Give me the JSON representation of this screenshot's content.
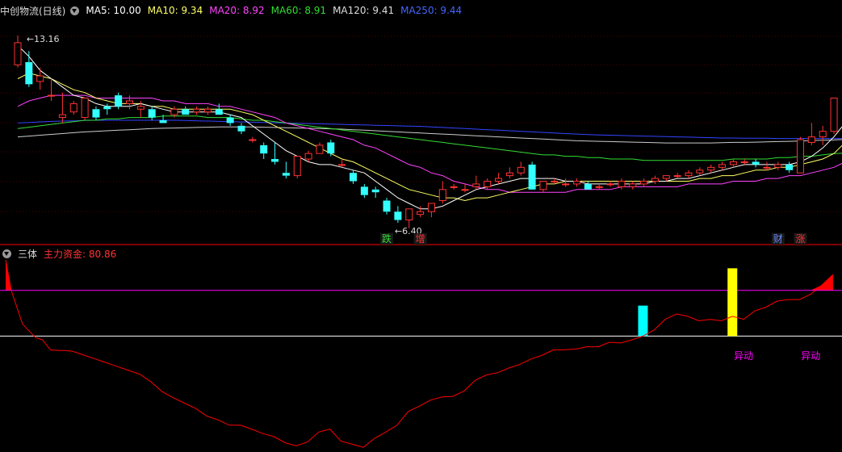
{
  "main_header": {
    "title": "中创物流(日线)",
    "ma": [
      {
        "label": "MA5: 10.00",
        "color": "#ffffff"
      },
      {
        "label": "MA10: 9.34",
        "color": "#ffff66"
      },
      {
        "label": "MA20: 8.92",
        "color": "#ff44ff"
      },
      {
        "label": "MA60: 8.91",
        "color": "#33dd33"
      },
      {
        "label": "MA120: 9.41",
        "color": "#dddddd"
      },
      {
        "label": "MA250: 9.44",
        "color": "#3344ff"
      }
    ]
  },
  "sub_header": {
    "name": "三体",
    "indicator_label": "主力资金: 80.86"
  },
  "colors": {
    "up": "#ff3333",
    "down": "#33ffff",
    "ma5": "#ffffff",
    "ma10": "#ffff66",
    "ma20": "#ff44ff",
    "ma60": "#33dd33",
    "ma250": "#3344ff",
    "grid": "#550000",
    "divider": "#aa0000",
    "signal_cyan": "#00ffff",
    "signal_yellow": "#ffff00",
    "line_white": "#ffffff",
    "line_magenta": "#ff00ff",
    "line_red": "#ff0000"
  },
  "chart_data": [
    {
      "type": "candlestick",
      "title": "中创物流(日线)",
      "ylim": [
        5.7,
        13.8
      ],
      "candles": [
        [
          12.1,
          13.16,
          12.0,
          12.9
        ],
        [
          12.2,
          12.6,
          11.3,
          11.4
        ],
        [
          11.5,
          12.0,
          11.2,
          11.7
        ],
        [
          11.0,
          11.6,
          10.8,
          11.0
        ],
        [
          10.2,
          11.1,
          10.0,
          10.3
        ],
        [
          10.4,
          10.8,
          10.3,
          10.7
        ],
        [
          10.2,
          10.9,
          10.1,
          10.9
        ],
        [
          10.5,
          10.6,
          10.1,
          10.2
        ],
        [
          10.6,
          10.7,
          10.3,
          10.5
        ],
        [
          11.0,
          11.1,
          10.5,
          10.6
        ],
        [
          10.7,
          11.0,
          10.5,
          10.8
        ],
        [
          10.5,
          10.8,
          10.2,
          10.6
        ],
        [
          10.5,
          10.6,
          10.1,
          10.2
        ],
        [
          10.1,
          10.3,
          10.0,
          10.0
        ],
        [
          10.3,
          10.6,
          10.2,
          10.5
        ],
        [
          10.5,
          10.6,
          10.3,
          10.3
        ],
        [
          10.4,
          10.6,
          10.3,
          10.5
        ],
        [
          10.4,
          10.6,
          10.3,
          10.5
        ],
        [
          10.5,
          10.7,
          10.3,
          10.3
        ],
        [
          10.2,
          10.3,
          9.9,
          10.0
        ],
        [
          9.9,
          10.0,
          9.6,
          9.7
        ],
        [
          9.4,
          9.5,
          9.3,
          9.4
        ],
        [
          9.2,
          9.3,
          8.7,
          8.9
        ],
        [
          8.7,
          9.3,
          8.5,
          8.6
        ],
        [
          8.2,
          8.6,
          8.0,
          8.1
        ],
        [
          8.1,
          8.8,
          8.0,
          8.8
        ],
        [
          8.7,
          9.0,
          8.6,
          8.9
        ],
        [
          8.9,
          9.3,
          8.9,
          9.2
        ],
        [
          9.3,
          9.4,
          8.8,
          8.9
        ],
        [
          8.5,
          8.7,
          8.4,
          8.5
        ],
        [
          8.2,
          8.3,
          7.8,
          7.9
        ],
        [
          7.7,
          7.8,
          7.3,
          7.4
        ],
        [
          7.6,
          7.7,
          7.3,
          7.5
        ],
        [
          7.2,
          7.3,
          6.7,
          6.8
        ],
        [
          6.8,
          7.0,
          6.4,
          6.5
        ],
        [
          6.5,
          6.9,
          6.2,
          6.9
        ],
        [
          6.7,
          7.0,
          6.6,
          6.8
        ],
        [
          6.8,
          7.1,
          6.6,
          7.1
        ],
        [
          7.2,
          7.9,
          7.1,
          7.6
        ],
        [
          7.7,
          7.8,
          7.6,
          7.7
        ],
        [
          7.6,
          7.8,
          7.5,
          7.6
        ],
        [
          7.7,
          8.1,
          7.6,
          7.8
        ],
        [
          7.7,
          8.0,
          7.6,
          7.9
        ],
        [
          7.9,
          8.2,
          7.8,
          8.0
        ],
        [
          8.1,
          8.4,
          8.0,
          8.2
        ],
        [
          8.2,
          8.6,
          8.1,
          8.4
        ],
        [
          8.5,
          8.6,
          7.6,
          7.6
        ],
        [
          7.6,
          7.9,
          7.5,
          7.9
        ],
        [
          7.9,
          8.0,
          7.8,
          7.9
        ],
        [
          7.8,
          8.0,
          7.7,
          7.8
        ],
        [
          7.8,
          8.0,
          7.7,
          7.9
        ],
        [
          7.8,
          7.9,
          7.6,
          7.6
        ],
        [
          7.7,
          7.8,
          7.6,
          7.7
        ],
        [
          7.8,
          7.9,
          7.7,
          7.8
        ],
        [
          7.7,
          8.0,
          7.6,
          7.9
        ],
        [
          7.7,
          7.9,
          7.6,
          7.8
        ],
        [
          7.8,
          8.0,
          7.7,
          7.9
        ],
        [
          7.9,
          8.1,
          7.8,
          8.0
        ],
        [
          8.0,
          8.1,
          7.9,
          8.1
        ],
        [
          8.1,
          8.2,
          8.0,
          8.1
        ],
        [
          8.1,
          8.3,
          8.0,
          8.2
        ],
        [
          8.2,
          8.4,
          8.1,
          8.3
        ],
        [
          8.3,
          8.5,
          8.2,
          8.4
        ],
        [
          8.4,
          8.6,
          8.3,
          8.5
        ],
        [
          8.5,
          8.7,
          8.4,
          8.6
        ],
        [
          8.6,
          8.7,
          8.5,
          8.6
        ],
        [
          8.6,
          8.7,
          8.4,
          8.5
        ],
        [
          8.4,
          8.6,
          8.3,
          8.4
        ],
        [
          8.4,
          8.6,
          8.3,
          8.5
        ],
        [
          8.5,
          8.6,
          8.2,
          8.3
        ],
        [
          8.2,
          9.5,
          8.2,
          9.4
        ],
        [
          9.3,
          10.0,
          9.2,
          9.5
        ],
        [
          9.5,
          9.9,
          9.2,
          9.7
        ],
        [
          9.7,
          10.9,
          9.6,
          10.9
        ]
      ],
      "ma5": [
        12.8,
        12.4,
        11.9,
        11.6,
        11.3,
        11.0,
        10.9,
        10.7,
        10.6,
        10.6,
        10.6,
        10.7,
        10.6,
        10.5,
        10.4,
        10.4,
        10.4,
        10.4,
        10.4,
        10.3,
        10.2,
        9.9,
        9.6,
        9.3,
        9.0,
        8.8,
        8.6,
        8.5,
        8.5,
        8.4,
        8.3,
        8.2,
        7.9,
        7.6,
        7.3,
        7.1,
        6.9,
        6.9,
        7.0,
        7.2,
        7.4,
        7.6,
        7.7,
        7.8,
        7.9,
        8.0,
        8.0,
        8.0,
        8.0,
        7.9,
        7.9,
        7.8,
        7.8,
        7.8,
        7.8,
        7.8,
        7.8,
        7.9,
        7.9,
        8.0,
        8.0,
        8.1,
        8.2,
        8.3,
        8.4,
        8.5,
        8.5,
        8.5,
        8.5,
        8.5,
        8.6,
        8.8,
        9.1,
        9.5,
        10.0
      ],
      "ma10": [
        11.6,
        11.8,
        11.7,
        11.6,
        11.4,
        11.2,
        11.1,
        10.9,
        10.8,
        10.7,
        10.7,
        10.7,
        10.6,
        10.6,
        10.5,
        10.5,
        10.5,
        10.5,
        10.5,
        10.5,
        10.4,
        10.3,
        10.1,
        9.9,
        9.7,
        9.5,
        9.3,
        9.1,
        8.9,
        8.7,
        8.6,
        8.4,
        8.2,
        8.0,
        7.8,
        7.6,
        7.5,
        7.4,
        7.3,
        7.3,
        7.2,
        7.3,
        7.3,
        7.4,
        7.5,
        7.6,
        7.7,
        7.8,
        7.8,
        7.9,
        7.9,
        7.9,
        7.9,
        7.9,
        7.9,
        7.9,
        7.9,
        7.9,
        7.9,
        7.9,
        7.9,
        8.0,
        8.0,
        8.1,
        8.1,
        8.2,
        8.3,
        8.3,
        8.4,
        8.4,
        8.5,
        8.6,
        8.7,
        8.9,
        9.3
      ],
      "ma20": [
        10.6,
        10.8,
        10.9,
        11.0,
        11.0,
        11.0,
        11.0,
        10.9,
        10.9,
        10.9,
        10.9,
        10.9,
        10.9,
        10.8,
        10.8,
        10.7,
        10.7,
        10.7,
        10.6,
        10.6,
        10.5,
        10.4,
        10.3,
        10.2,
        10.0,
        9.9,
        9.8,
        9.7,
        9.6,
        9.5,
        9.4,
        9.2,
        9.1,
        8.9,
        8.7,
        8.5,
        8.4,
        8.2,
        8.1,
        7.9,
        7.8,
        7.7,
        7.6,
        7.6,
        7.5,
        7.5,
        7.5,
        7.5,
        7.5,
        7.5,
        7.6,
        7.6,
        7.6,
        7.6,
        7.7,
        7.7,
        7.7,
        7.7,
        7.7,
        7.7,
        7.8,
        7.8,
        7.8,
        7.8,
        7.9,
        7.9,
        7.9,
        8.0,
        8.0,
        8.1,
        8.1,
        8.2,
        8.3,
        8.4,
        8.6
      ],
      "ma60": [
        9.8,
        9.85,
        9.9,
        9.95,
        10.0,
        10.05,
        10.1,
        10.1,
        10.15,
        10.15,
        10.2,
        10.2,
        10.2,
        10.25,
        10.25,
        10.25,
        10.25,
        10.2,
        10.2,
        10.2,
        10.15,
        10.1,
        10.1,
        10.05,
        10.0,
        9.95,
        9.9,
        9.85,
        9.8,
        9.75,
        9.7,
        9.65,
        9.6,
        9.55,
        9.5,
        9.45,
        9.4,
        9.35,
        9.3,
        9.25,
        9.2,
        9.15,
        9.1,
        9.05,
        9.0,
        8.95,
        8.9,
        8.85,
        8.85,
        8.8,
        8.8,
        8.75,
        8.75,
        8.7,
        8.7,
        8.7,
        8.65,
        8.65,
        8.65,
        8.65,
        8.65,
        8.65,
        8.65,
        8.65,
        8.7,
        8.7,
        8.7,
        8.7,
        8.75,
        8.75,
        8.8,
        8.8,
        8.85,
        8.9,
        8.91
      ],
      "ma120": [
        9.5,
        9.53,
        9.56,
        9.59,
        9.62,
        9.65,
        9.68,
        9.7,
        9.72,
        9.74,
        9.76,
        9.78,
        9.8,
        9.81,
        9.82,
        9.83,
        9.84,
        9.85,
        9.86,
        9.86,
        9.86,
        9.86,
        9.85,
        9.84,
        9.83,
        9.82,
        9.81,
        9.8,
        9.79,
        9.78,
        9.76,
        9.74,
        9.72,
        9.7,
        9.68,
        9.66,
        9.64,
        9.62,
        9.6,
        9.58,
        9.56,
        9.54,
        9.52,
        9.5,
        9.48,
        9.46,
        9.44,
        9.42,
        9.4,
        9.38,
        9.36,
        9.35,
        9.34,
        9.33,
        9.32,
        9.31,
        9.3,
        9.29,
        9.28,
        9.28,
        9.28,
        9.28,
        9.28,
        9.29,
        9.3,
        9.3,
        9.31,
        9.32,
        9.33,
        9.34,
        9.35,
        9.37,
        9.38,
        9.39,
        9.41
      ],
      "ma250": [
        10.0,
        10.02,
        10.04,
        10.06,
        10.07,
        10.08,
        10.09,
        10.1,
        10.1,
        10.1,
        10.1,
        10.1,
        10.1,
        10.1,
        10.1,
        10.09,
        10.08,
        10.07,
        10.06,
        10.05,
        10.04,
        10.03,
        10.02,
        10.01,
        10.0,
        9.99,
        9.98,
        9.97,
        9.96,
        9.95,
        9.94,
        9.93,
        9.92,
        9.91,
        9.9,
        9.89,
        9.88,
        9.86,
        9.84,
        9.82,
        9.8,
        9.78,
        9.76,
        9.74,
        9.72,
        9.7,
        9.68,
        9.66,
        9.64,
        9.62,
        9.6,
        9.58,
        9.57,
        9.56,
        9.55,
        9.54,
        9.53,
        9.52,
        9.51,
        9.5,
        9.49,
        9.48,
        9.47,
        9.46,
        9.46,
        9.45,
        9.45,
        9.45,
        9.44,
        9.44,
        9.44,
        9.44,
        9.44,
        9.44,
        9.44
      ],
      "annotations": [
        {
          "text": "13.16",
          "x": 1,
          "y": 13.16
        },
        {
          "text": "6.40",
          "x": 34,
          "y": 6.4
        },
        {
          "text": "跌",
          "x": 33,
          "color": "#33dd33"
        },
        {
          "text": "增",
          "x": 36,
          "color": "#ff3333"
        },
        {
          "text": "财",
          "x": 68,
          "color": "#6688ff"
        },
        {
          "text": "涨",
          "x": 70,
          "color": "#ff3333"
        }
      ]
    },
    {
      "type": "line",
      "title": "三体",
      "series_name": "主力资金",
      "last_value": 80.86,
      "ylim": [
        -150,
        100
      ],
      "fill_above": 60,
      "hline_magenta": 60,
      "hline_white": 0,
      "values": [
        [
          0,
          100
        ],
        [
          0.5,
          60
        ],
        [
          1,
          38
        ],
        [
          1.5,
          16
        ],
        [
          2,
          8
        ],
        [
          2.7,
          -2
        ],
        [
          3.3,
          -5
        ],
        [
          4,
          -18
        ],
        [
          4.7,
          -19
        ],
        [
          5.3,
          -19
        ],
        [
          6,
          -20
        ],
        [
          7,
          -25
        ],
        [
          8,
          -30
        ],
        [
          9,
          -35
        ],
        [
          10,
          -40
        ],
        [
          11,
          -45
        ],
        [
          12,
          -50
        ],
        [
          13,
          -60
        ],
        [
          14,
          -73
        ],
        [
          15,
          -81
        ],
        [
          16,
          -88
        ],
        [
          17,
          -95
        ],
        [
          18,
          -105
        ],
        [
          19,
          -110
        ],
        [
          20,
          -117
        ],
        [
          21,
          -117
        ],
        [
          22,
          -122
        ],
        [
          23,
          -128
        ],
        [
          24,
          -132
        ],
        [
          25,
          -140
        ],
        [
          26,
          -144
        ],
        [
          27,
          -139
        ],
        [
          28,
          -126
        ],
        [
          29,
          -122
        ],
        [
          30,
          -138
        ],
        [
          31,
          -142
        ],
        [
          32,
          -146
        ],
        [
          33,
          -134
        ],
        [
          34,
          -126
        ],
        [
          35,
          -117
        ],
        [
          36,
          -99
        ],
        [
          37,
          -92
        ],
        [
          38,
          -84
        ],
        [
          39,
          -80
        ],
        [
          40,
          -79
        ],
        [
          41,
          -72
        ],
        [
          42,
          -58
        ],
        [
          43,
          -51
        ],
        [
          44,
          -48
        ],
        [
          45,
          -42
        ],
        [
          46,
          -37
        ],
        [
          47,
          -30
        ],
        [
          48,
          -25
        ],
        [
          49,
          -18
        ],
        [
          50,
          -18
        ],
        [
          51,
          -17
        ],
        [
          52,
          -14
        ],
        [
          53,
          -14
        ],
        [
          54,
          -8
        ],
        [
          55,
          -9
        ],
        [
          56,
          -5
        ],
        [
          57,
          0
        ],
        [
          58,
          8
        ],
        [
          59,
          22
        ],
        [
          60,
          29
        ],
        [
          61,
          26
        ],
        [
          62,
          20
        ],
        [
          63,
          22
        ],
        [
          64,
          20
        ],
        [
          65,
          26
        ],
        [
          66,
          22
        ],
        [
          67,
          33
        ],
        [
          68,
          38
        ],
        [
          69,
          46
        ],
        [
          70,
          48
        ],
        [
          71,
          48
        ],
        [
          72,
          55
        ],
        [
          73,
          67
        ],
        [
          74,
          80.86
        ]
      ],
      "signals": [
        {
          "x": 57,
          "height": 40,
          "color": "#00ffff"
        },
        {
          "x": 65,
          "height": 89,
          "color": "#ffff00"
        }
      ],
      "labels": [
        {
          "text": "异动",
          "x": 66
        },
        {
          "text": "异动",
          "x": 72
        }
      ]
    }
  ]
}
